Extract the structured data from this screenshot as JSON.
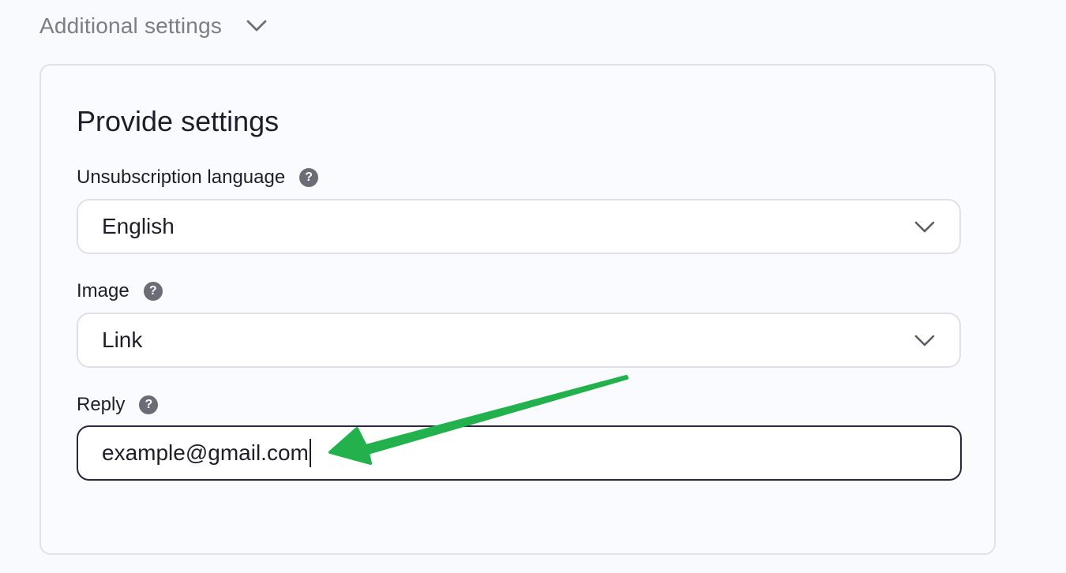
{
  "section": {
    "label": "Additional settings",
    "expand_icon": "chevron-down-icon"
  },
  "card": {
    "title": "Provide settings"
  },
  "fields": {
    "unsubscription_language": {
      "label": "Unsubscription language",
      "value": "English",
      "help_icon": "help-icon"
    },
    "image": {
      "label": "Image",
      "value": "Link",
      "help_icon": "help-icon"
    },
    "reply": {
      "label": "Reply",
      "value": "example@gmail.com",
      "help_icon": "help-icon"
    }
  },
  "help_glyph": "?",
  "colors": {
    "focus_border": "#2b2540",
    "annotation_arrow": "#22b14c",
    "help_icon_bg": "#6c6c77"
  }
}
